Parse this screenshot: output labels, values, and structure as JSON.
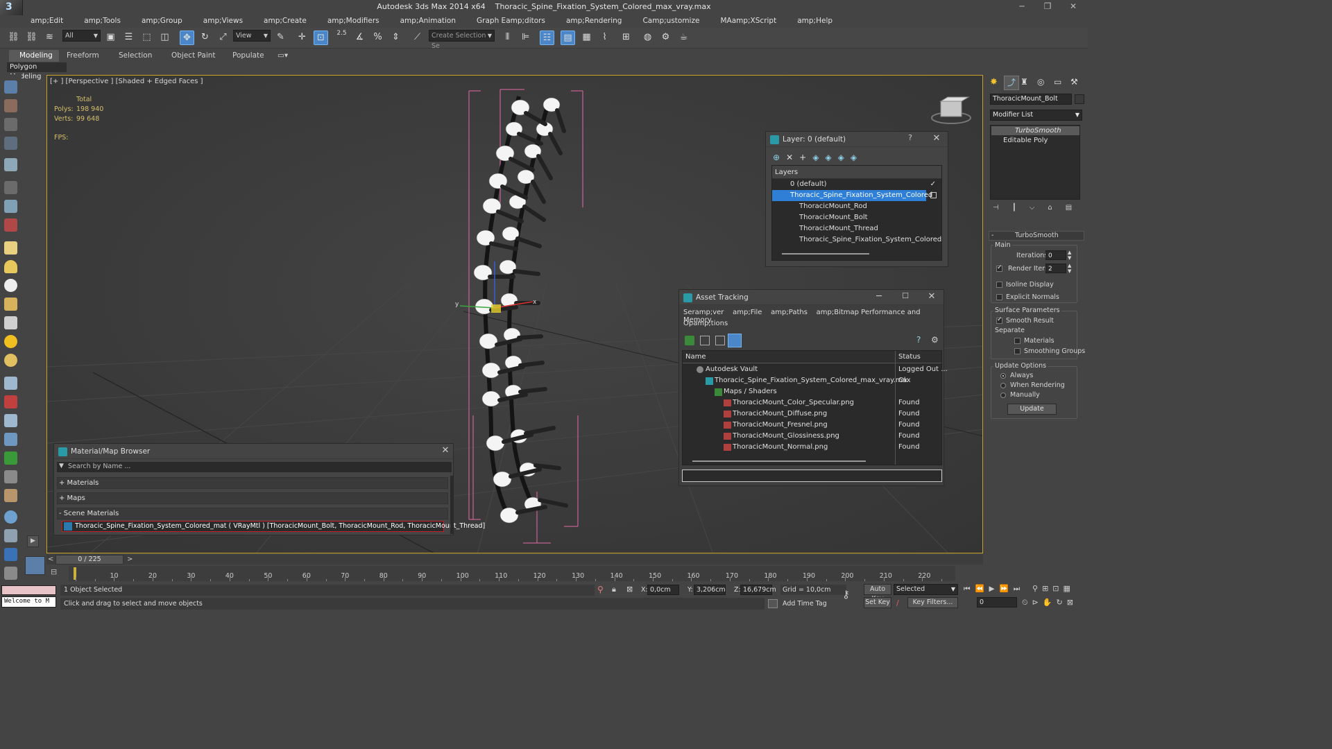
{
  "window": {
    "app_title": "Autodesk 3ds Max  2014 x64",
    "file_title": "Thoracic_Spine_Fixation_System_Colored_max_vray.max",
    "logo_glyph": "3"
  },
  "menu": [
    "amp;Edit",
    "amp;Tools",
    "amp;Group",
    "amp;Views",
    "amp;Create",
    "amp;Modifiers",
    "amp;Animation",
    "Graph Eamp;ditors",
    "amp;Rendering",
    "Camp;ustomize",
    "MAamp;XScript",
    "amp;Help"
  ],
  "toolbar": {
    "selection_filter": "All",
    "ref_coord": "View",
    "angle_snap": "2.5",
    "named_selection": "Create Selection Se"
  },
  "ribbon": {
    "tabs": [
      "Modeling",
      "Freeform",
      "Selection",
      "Object Paint",
      "Populate"
    ],
    "active_tab": "Modeling",
    "panel_label": "Polygon Modeling"
  },
  "viewport": {
    "label": "[+ ] [Perspective ] [Shaded + Edged Faces ]",
    "stats_header": "Total",
    "polys_label": "Polys:",
    "polys_value": "198 940",
    "verts_label": "Verts:",
    "verts_value": "99 648",
    "fps_label": "FPS:"
  },
  "layer_dialog": {
    "title": "Layer: 0 (default)",
    "help": "?",
    "header": "Layers",
    "rows": [
      {
        "name": "0 (default)",
        "indent": 0,
        "mark": "✓"
      },
      {
        "name": "Thoracic_Spine_Fixation_System_Colored",
        "indent": 0,
        "selected": true
      },
      {
        "name": "ThoracicMount_Rod",
        "indent": 1
      },
      {
        "name": "ThoracicMount_Bolt",
        "indent": 1
      },
      {
        "name": "ThoracicMount_Thread",
        "indent": 1
      },
      {
        "name": "Thoracic_Spine_Fixation_System_Colored",
        "indent": 1
      }
    ]
  },
  "asset_tracking": {
    "title": "Asset Tracking",
    "menu": [
      "Seramp;ver",
      "amp;File",
      "amp;Paths",
      "amp;Bitmap Performance and Memory"
    ],
    "menu2": "Opamp;tions",
    "col_name": "Name",
    "col_status": "Status",
    "rows": [
      {
        "name": "Autodesk Vault",
        "status": "Logged Out ...",
        "indent": 0
      },
      {
        "name": "Thoracic_Spine_Fixation_System_Colored_max_vray.max",
        "status": "Ok",
        "indent": 1
      },
      {
        "name": "Maps / Shaders",
        "status": "",
        "indent": 2
      },
      {
        "name": "ThoracicMount_Color_Specular.png",
        "status": "Found",
        "indent": 3
      },
      {
        "name": "ThoracicMount_Diffuse.png",
        "status": "Found",
        "indent": 3
      },
      {
        "name": "ThoracicMount_Fresnel.png",
        "status": "Found",
        "indent": 3
      },
      {
        "name": "ThoracicMount_Glossiness.png",
        "status": "Found",
        "indent": 3
      },
      {
        "name": "ThoracicMount_Normal.png",
        "status": "Found",
        "indent": 3
      }
    ]
  },
  "material_browser": {
    "title": "Material/Map Browser",
    "search_placeholder": "Search by Name ...",
    "groups": [
      "+ Materials",
      "+ Maps",
      "- Scene Materials"
    ],
    "scene_material": "Thoracic_Spine_Fixation_System_Colored_mat  ( VRayMtl ) [ThoracicMount_Bolt, ThoracicMount_Rod, ThoracicMount_Thread]"
  },
  "command_panel": {
    "object_name": "ThoracicMount_Bolt",
    "modifier_list": "Modifier List",
    "stack": [
      "TurboSmooth",
      "Editable Poly"
    ],
    "rollout_title": "TurboSmooth",
    "main_label": "Main",
    "iterations_label": "Iterations:",
    "iterations_value": "0",
    "render_iters_label": "Render Iters:",
    "render_iters_value": "2",
    "render_iters_checked": true,
    "isoline_label": "Isoline Display",
    "explicit_normals_label": "Explicit Normals",
    "surface_params_label": "Surface Parameters",
    "smooth_result_label": "Smooth Result",
    "separate_label": "Separate",
    "materials_label": "Materials",
    "smoothing_groups_label": "Smoothing Groups",
    "update_options_label": "Update Options",
    "always_label": "Always",
    "when_rendering_label": "When Rendering",
    "manually_label": "Manually",
    "update_button": "Update"
  },
  "timeline": {
    "frame_display": "0 / 225",
    "prev": "<",
    "next": ">",
    "ticks": [
      "10",
      "20",
      "30",
      "40",
      "50",
      "60",
      "70",
      "80",
      "90",
      "100",
      "110",
      "120",
      "130",
      "140",
      "150",
      "160",
      "170",
      "180",
      "190",
      "200",
      "210",
      "220"
    ]
  },
  "status": {
    "listener": "Welcome to M",
    "selection": "1 Object Selected",
    "prompt": "Click and drag to select and move objects",
    "x_label": "X:",
    "x_value": "0,0cm",
    "y_label": "Y:",
    "y_value": "3,206cm",
    "z_label": "Z:",
    "z_value": "16,679cm",
    "grid": "Grid = 10,0cm",
    "add_time_tag": "Add Time Tag",
    "auto_key": "Auto Key",
    "set_key": "Set Key",
    "key_mode": "Selected",
    "key_filters": "Key Filters...",
    "frame_value": "0"
  },
  "colors": {
    "selection_blue": "#2f7fd6",
    "bounding_box": "#e46aa6",
    "stats_yellow": "#d6c06a",
    "material_red": "#c4202a"
  }
}
